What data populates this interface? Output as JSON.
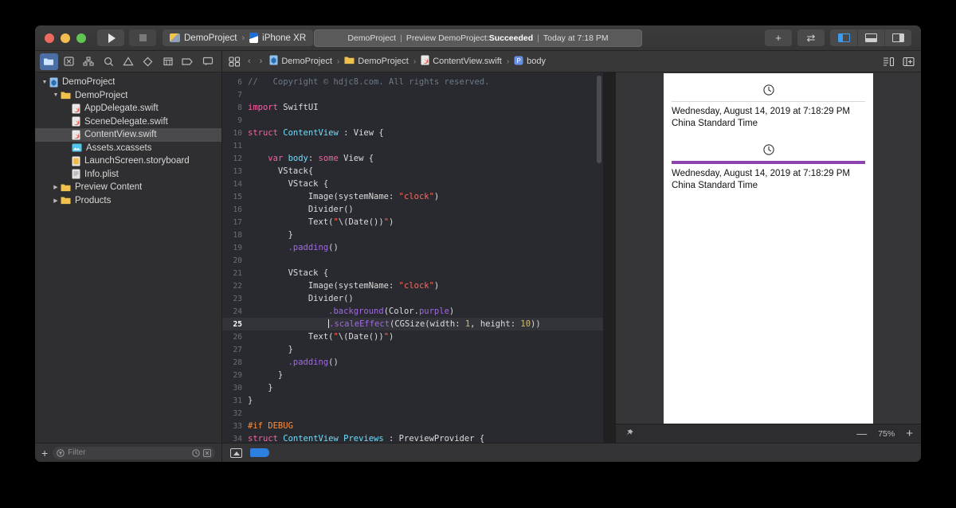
{
  "window": {
    "traffic_lights": [
      "close",
      "minimize",
      "zoom"
    ],
    "toolbar": {
      "run_label": "Run",
      "stop_label": "Stop",
      "scheme_project": "DemoProject",
      "scheme_separator": "›",
      "scheme_device": "iPhone XR",
      "add_label": "+",
      "swap_label": "⇄",
      "panel_left": "left-panel",
      "panel_bottom": "bottom-panel",
      "panel_right": "right-panel"
    },
    "status": {
      "project": "DemoProject",
      "pipe": "|",
      "activity": "Preview DemoProject:",
      "result": "Succeeded",
      "time": "Today at 7:18 PM"
    }
  },
  "navigator": {
    "tabs": [
      {
        "name": "project-navigator",
        "active": true
      },
      {
        "name": "source-control-navigator",
        "active": false
      },
      {
        "name": "symbol-navigator",
        "active": false
      },
      {
        "name": "find-navigator",
        "active": false
      },
      {
        "name": "issue-navigator",
        "active": false
      },
      {
        "name": "test-navigator",
        "active": false
      },
      {
        "name": "debug-navigator",
        "active": false
      },
      {
        "name": "breakpoint-navigator",
        "active": false
      },
      {
        "name": "report-navigator",
        "active": false
      }
    ],
    "tree": [
      {
        "label": "DemoProject",
        "depth": 0,
        "icon": "project",
        "twisty": "down",
        "selected": false
      },
      {
        "label": "DemoProject",
        "depth": 1,
        "icon": "folder",
        "twisty": "down",
        "selected": false
      },
      {
        "label": "AppDelegate.swift",
        "depth": 2,
        "icon": "swift",
        "twisty": "none",
        "selected": false
      },
      {
        "label": "SceneDelegate.swift",
        "depth": 2,
        "icon": "swift",
        "twisty": "none",
        "selected": false
      },
      {
        "label": "ContentView.swift",
        "depth": 2,
        "icon": "swift",
        "twisty": "none",
        "selected": true
      },
      {
        "label": "Assets.xcassets",
        "depth": 2,
        "icon": "assets",
        "twisty": "none",
        "selected": false
      },
      {
        "label": "LaunchScreen.storyboard",
        "depth": 2,
        "icon": "story",
        "twisty": "none",
        "selected": false
      },
      {
        "label": "Info.plist",
        "depth": 2,
        "icon": "plist",
        "twisty": "none",
        "selected": false
      },
      {
        "label": "Preview Content",
        "depth": 1,
        "icon": "folder",
        "twisty": "right",
        "selected": false
      },
      {
        "label": "Products",
        "depth": 1,
        "icon": "folder",
        "twisty": "right",
        "selected": false
      }
    ],
    "footer": {
      "add_label": "+",
      "filter_placeholder": "Filter",
      "recent_icon": "clock-icon",
      "cancel_icon": "clear-icon"
    }
  },
  "breadcrumb": {
    "items": [
      {
        "label": "DemoProject",
        "icon": "project"
      },
      {
        "label": "DemoProject",
        "icon": "folder"
      },
      {
        "label": "ContentView.swift",
        "icon": "swift"
      },
      {
        "label": "body",
        "icon": "property"
      }
    ],
    "separator": "›",
    "back": "‹",
    "forward": "›"
  },
  "code": {
    "current_line": 25,
    "lines": [
      {
        "n": "6",
        "tokens": [
          {
            "t": "//   Copyright © hdjc8.com. All rights reserved.",
            "c": "c"
          }
        ]
      },
      {
        "n": "7",
        "tokens": []
      },
      {
        "n": "8",
        "tokens": [
          {
            "t": "import",
            "c": "k"
          },
          {
            "t": " SwiftUI",
            "c": ""
          }
        ]
      },
      {
        "n": "9",
        "tokens": []
      },
      {
        "n": "10",
        "tokens": [
          {
            "t": "struct",
            "c": "k"
          },
          {
            "t": " ",
            "c": ""
          },
          {
            "t": "ContentView",
            "c": "t"
          },
          {
            "t": " : ",
            "c": ""
          },
          {
            "t": "View",
            "c": ""
          },
          {
            "t": " {",
            "c": ""
          }
        ]
      },
      {
        "n": "11",
        "tokens": []
      },
      {
        "n": "12",
        "tokens": [
          {
            "t": "    ",
            "c": ""
          },
          {
            "t": "var",
            "c": "k"
          },
          {
            "t": " ",
            "c": ""
          },
          {
            "t": "body",
            "c": "t"
          },
          {
            "t": ": ",
            "c": ""
          },
          {
            "t": "some",
            "c": "k"
          },
          {
            "t": " View {",
            "c": ""
          }
        ]
      },
      {
        "n": "13",
        "tokens": [
          {
            "t": "      VStack{",
            "c": ""
          }
        ]
      },
      {
        "n": "14",
        "tokens": [
          {
            "t": "        VStack {",
            "c": ""
          }
        ]
      },
      {
        "n": "15",
        "tokens": [
          {
            "t": "            Image(systemName: ",
            "c": ""
          },
          {
            "t": "\"clock\"",
            "c": "s"
          },
          {
            "t": ")",
            "c": ""
          }
        ]
      },
      {
        "n": "16",
        "tokens": [
          {
            "t": "            Divider()",
            "c": ""
          }
        ]
      },
      {
        "n": "17",
        "tokens": [
          {
            "t": "            Text(",
            "c": ""
          },
          {
            "t": "\"",
            "c": "s"
          },
          {
            "t": "\\(Date())",
            "c": ""
          },
          {
            "t": "\"",
            "c": "s"
          },
          {
            "t": ")",
            "c": ""
          }
        ]
      },
      {
        "n": "18",
        "tokens": [
          {
            "t": "        }",
            "c": ""
          }
        ]
      },
      {
        "n": "19",
        "tokens": [
          {
            "t": "        ",
            "c": ""
          },
          {
            "t": ".padding",
            "c": "m"
          },
          {
            "t": "()",
            "c": ""
          }
        ]
      },
      {
        "n": "20",
        "tokens": []
      },
      {
        "n": "21",
        "tokens": [
          {
            "t": "        VStack {",
            "c": ""
          }
        ]
      },
      {
        "n": "22",
        "tokens": [
          {
            "t": "            Image(systemName: ",
            "c": ""
          },
          {
            "t": "\"clock\"",
            "c": "s"
          },
          {
            "t": ")",
            "c": ""
          }
        ]
      },
      {
        "n": "23",
        "tokens": [
          {
            "t": "            Divider()",
            "c": ""
          }
        ]
      },
      {
        "n": "24",
        "tokens": [
          {
            "t": "                ",
            "c": ""
          },
          {
            "t": ".background",
            "c": "m"
          },
          {
            "t": "(Color.",
            "c": ""
          },
          {
            "t": "purple",
            "c": "m"
          },
          {
            "t": ")",
            "c": ""
          }
        ]
      },
      {
        "n": "25",
        "tokens": [
          {
            "t": "                ",
            "c": ""
          },
          {
            "t": "|CURSOR|",
            "c": "cursor"
          },
          {
            "t": ".scaleEffect",
            "c": "m"
          },
          {
            "t": "(CGSize(width: ",
            "c": ""
          },
          {
            "t": "1",
            "c": "n"
          },
          {
            "t": ", height: ",
            "c": ""
          },
          {
            "t": "10",
            "c": "n"
          },
          {
            "t": "))",
            "c": ""
          }
        ]
      },
      {
        "n": "26",
        "tokens": [
          {
            "t": "            Text(",
            "c": ""
          },
          {
            "t": "\"",
            "c": "s"
          },
          {
            "t": "\\(Date())",
            "c": ""
          },
          {
            "t": "\"",
            "c": "s"
          },
          {
            "t": ")",
            "c": ""
          }
        ]
      },
      {
        "n": "27",
        "tokens": [
          {
            "t": "        }",
            "c": ""
          }
        ]
      },
      {
        "n": "28",
        "tokens": [
          {
            "t": "        ",
            "c": ""
          },
          {
            "t": ".padding",
            "c": "m"
          },
          {
            "t": "()",
            "c": ""
          }
        ]
      },
      {
        "n": "29",
        "tokens": [
          {
            "t": "      }",
            "c": ""
          }
        ]
      },
      {
        "n": "30",
        "tokens": [
          {
            "t": "    }",
            "c": ""
          }
        ]
      },
      {
        "n": "31",
        "tokens": [
          {
            "t": "}",
            "c": ""
          }
        ]
      },
      {
        "n": "32",
        "tokens": []
      },
      {
        "n": "33",
        "tokens": [
          {
            "t": "#if DEBUG",
            "c": "pp"
          }
        ]
      },
      {
        "n": "34",
        "tokens": [
          {
            "t": "struct",
            "c": "k"
          },
          {
            "t": " ",
            "c": ""
          },
          {
            "t": "ContentView_Previews",
            "c": "t"
          },
          {
            "t": " : ",
            "c": ""
          },
          {
            "t": "PreviewProvider",
            "c": ""
          },
          {
            "t": " {",
            "c": ""
          }
        ]
      }
    ]
  },
  "preview": {
    "stacks": [
      {
        "icon": "clock-icon",
        "divider": "plain",
        "divider_color": "#d6d6d6",
        "text": "Wednesday, August 14, 2019 at 7:18:29 PM China Standard Time"
      },
      {
        "icon": "clock-icon",
        "divider": "purple",
        "divider_color": "#8e44ad",
        "text": "Wednesday, August 14, 2019 at 7:18:29 PM China Standard Time"
      }
    ],
    "bar": {
      "pin_icon": "pin-icon",
      "zoom_out": "—",
      "zoom_level": "75%",
      "zoom_in": "+"
    }
  },
  "editor_footer": {
    "breakpoint_icon": "breakpoint-icon",
    "assistant_icon": "assistant-icon"
  }
}
